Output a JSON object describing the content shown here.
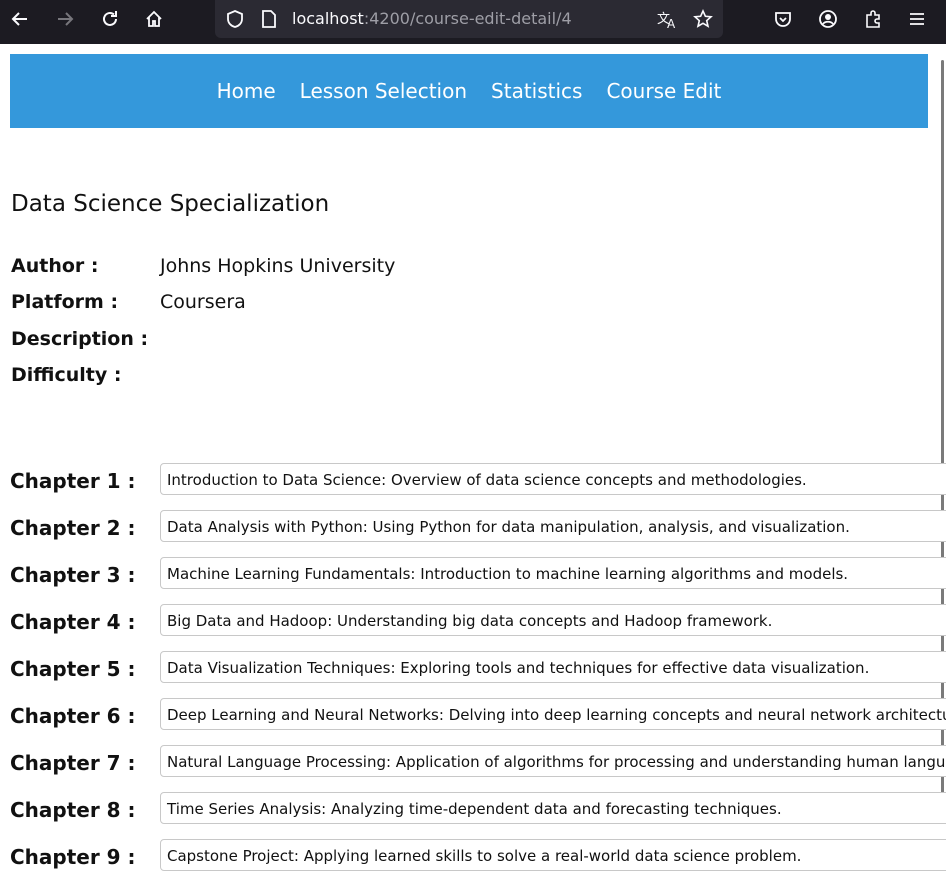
{
  "browser": {
    "url_host": "localhost",
    "url_path": ":4200/course-edit-detail/4",
    "icons": [
      "back-icon",
      "forward-icon",
      "reload-icon",
      "home-icon",
      "shield-icon",
      "page-icon",
      "translate-icon",
      "star-icon",
      "pocket-icon",
      "account-icon",
      "extensions-icon",
      "menu-icon"
    ]
  },
  "nav": {
    "links": [
      "Home",
      "Lesson Selection",
      "Statistics",
      "Course Edit"
    ]
  },
  "course": {
    "title": "Data Science Specialization",
    "fields": [
      {
        "label": "Author :",
        "value": "Johns Hopkins University"
      },
      {
        "label": "Platform :",
        "value": "Coursera"
      },
      {
        "label": "Description :",
        "value": ""
      },
      {
        "label": "Difficulty :",
        "value": ""
      }
    ]
  },
  "chapters": [
    {
      "label": "Chapter 1 :",
      "value": "Introduction to Data Science: Overview of data science concepts and methodologies."
    },
    {
      "label": "Chapter 2 :",
      "value": "Data Analysis with Python: Using Python for data manipulation, analysis, and visualization."
    },
    {
      "label": "Chapter 3 :",
      "value": "Machine Learning Fundamentals: Introduction to machine learning algorithms and models."
    },
    {
      "label": "Chapter 4 :",
      "value": "Big Data and Hadoop: Understanding big data concepts and Hadoop framework."
    },
    {
      "label": "Chapter 5 :",
      "value": "Data Visualization Techniques: Exploring tools and techniques for effective data visualization."
    },
    {
      "label": "Chapter 6 :",
      "value": "Deep Learning and Neural Networks: Delving into deep learning concepts and neural network architecture"
    },
    {
      "label": "Chapter 7 :",
      "value": "Natural Language Processing: Application of algorithms for processing and understanding human language"
    },
    {
      "label": "Chapter 8 :",
      "value": "Time Series Analysis: Analyzing time-dependent data and forecasting techniques."
    },
    {
      "label": "Chapter 9 :",
      "value": "Capstone Project: Applying learned skills to solve a real-world data science problem."
    }
  ]
}
